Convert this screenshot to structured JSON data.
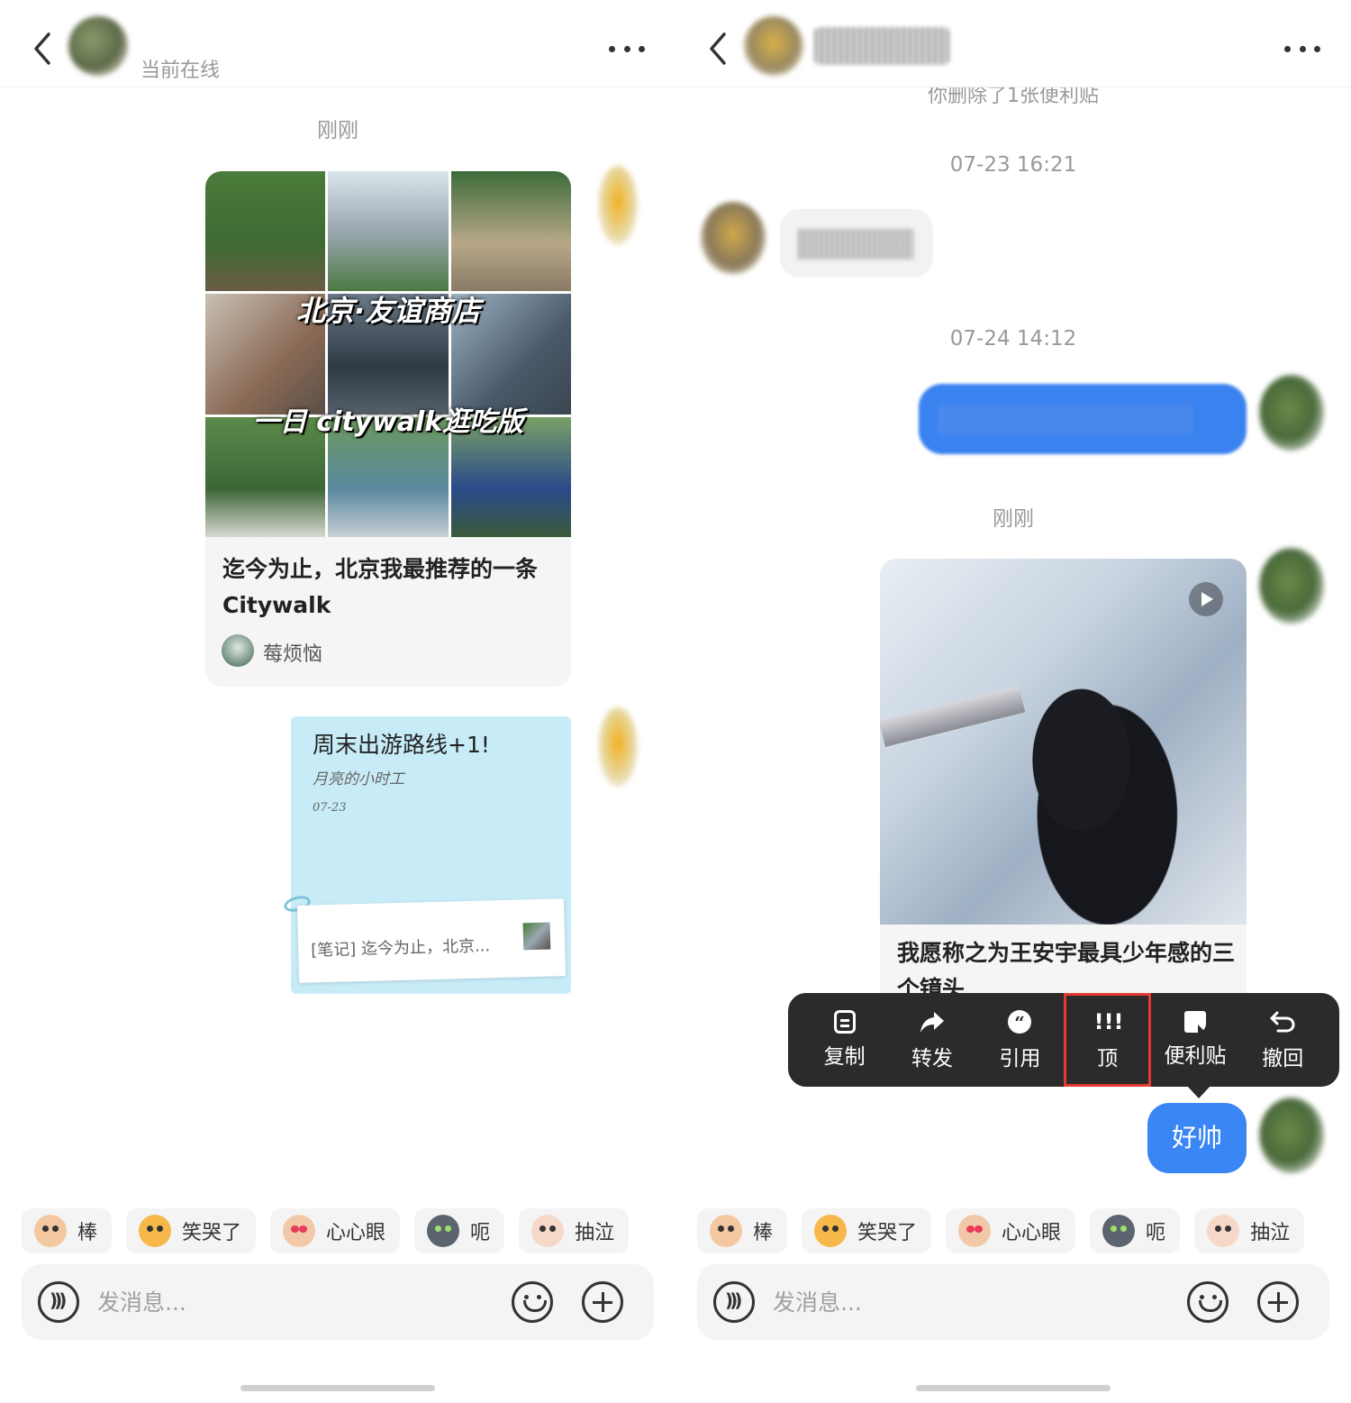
{
  "left": {
    "header": {
      "status": "当前在线"
    },
    "time_label": "刚刚",
    "note_card": {
      "cover_title_1": "北京·友谊商店",
      "cover_title_2": "一日 citywalk逛吃版",
      "title": "迄今为止，北京我最推荐的一条 Citywalk",
      "author": "莓烦恼"
    },
    "sticky": {
      "title": "周末出游路线+1!",
      "subtitle": "月亮的小时工",
      "date": "07-23",
      "ref_text": "[笔记] 迄今为止，北京..."
    }
  },
  "right": {
    "system_notice": "你删除了1张便利贴",
    "time_1": "07-23 16:21",
    "time_2": "07-24 14:12",
    "time_3": "刚刚",
    "video_card": {
      "title": "我愿称之为王安宇最具少年感的三个镜头"
    },
    "context_menu": [
      {
        "label": "复制",
        "icon": "copy-icon"
      },
      {
        "label": "转发",
        "icon": "forward-icon"
      },
      {
        "label": "引用",
        "icon": "quote-icon"
      },
      {
        "label": "顶",
        "icon": "bump-icon",
        "highlighted": true
      },
      {
        "label": "便利贴",
        "icon": "sticky-note-icon"
      },
      {
        "label": "撤回",
        "icon": "recall-icon"
      }
    ],
    "last_message": "好帅"
  },
  "quick_reactions": [
    "棒",
    "笑哭了",
    "心心眼",
    "呃",
    "抽泣"
  ],
  "input": {
    "placeholder": "发消息..."
  },
  "colors": {
    "accent_blue": "#3a86f5",
    "menu_bg": "#2b2b2b",
    "highlight_red": "#e53935",
    "sticky_blue": "#c7ecf8"
  }
}
